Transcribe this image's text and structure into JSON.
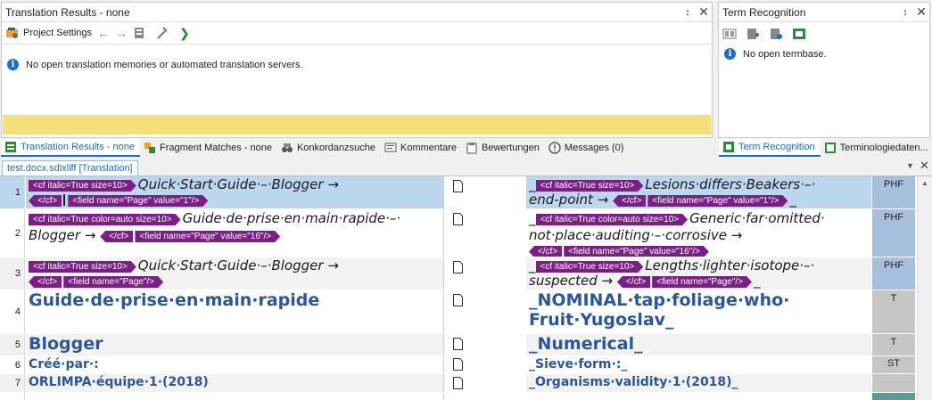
{
  "translation_results": {
    "title": "Translation Results - none",
    "toolbar_project_settings": "Project Settings",
    "message": "No open translation memories or automated translation servers."
  },
  "term_recognition": {
    "title": "Term Recognition",
    "message": "No open termbase."
  },
  "bottom_tabs": [
    {
      "label": "Translation Results - none"
    },
    {
      "label": "Fragment Matches - none"
    },
    {
      "label": "Konkordanzsuche"
    },
    {
      "label": "Kommentare"
    },
    {
      "label": "Bewertungen"
    },
    {
      "label": "Messages (0)"
    }
  ],
  "right_tabs": [
    {
      "label": "Term Recognition"
    },
    {
      "label": "Terminologiedaten..."
    }
  ],
  "editor_tab": "test.docx.sdlxliff [Translation]",
  "rows": [
    {
      "num": "1",
      "src_tag1": "<cf italic=True size=10>",
      "src_text": "Quick·Start·Guide·–·Blogger →",
      "src_tag2": "</cf>",
      "src_tag3": "<field name=\"Page\" value=\"1\"/>",
      "tgt_prefix": "_",
      "tgt_tag1": "<cf italic=True size=10>",
      "tgt_text": "Lesions·differs·Beakers·–·",
      "tgt_text2": "end-point →",
      "tgt_tag2": "</cf>",
      "tgt_tag3": "<field name=\"Page\" value=\"1\"/>",
      "tgt_suffix": "_",
      "status": "PHF"
    },
    {
      "num": "2",
      "src_tag1": "<cf italic=True color=auto size=10>",
      "src_text": "Guide·de·prise·en·main·rapide·–·",
      "src_text2": "Blogger →",
      "src_tag2": "</cf>",
      "src_tag3": "<field name=\"Page\" value=\"16\"/>",
      "tgt_prefix": "_",
      "tgt_tag1": "<cf italic=True color=auto size=10>",
      "tgt_text": "Generic·far·omitted·",
      "tgt_text2": "not·place·auditing·–·corrosive →",
      "tgt_tag2": "</cf>",
      "tgt_tag3": "<field name=\"Page\" value=\"16\"/>",
      "tgt_suffix": "_",
      "status": "PHF"
    },
    {
      "num": "3",
      "src_tag1": "<cf italic=True size=10>",
      "src_text": "Quick·Start·Guide·–·Blogger →",
      "src_tag2": "</cf>",
      "src_tag3": "<field name=\"Page\"/>",
      "tgt_prefix": "_",
      "tgt_tag1": "<cf italic=True size=10>",
      "tgt_text": "Lengths·lighter·isotope·–·",
      "tgt_text2": "suspected →",
      "tgt_tag2": "</cf>",
      "tgt_tag3": "<field name=\"Page\"/>",
      "tgt_suffix": "_",
      "status": "PHF"
    },
    {
      "num": "4",
      "src_text": "Guide·de·prise·en·main·rapide",
      "tgt_text": "_NOMINAL·tap·foliage·who·",
      "tgt_text2": "Fruit·Yugoslav_",
      "status": "T"
    },
    {
      "num": "5",
      "src_text": "Blogger",
      "tgt_text": "_Numerical_",
      "status": "T"
    },
    {
      "num": "6",
      "src_text": "Créé·par·:",
      "tgt_text": "_Sieve·form·:_",
      "status": "ST"
    },
    {
      "num": "7",
      "src_text": "ORLIMPA·équipe·1·(2018)",
      "tgt_text": "_Organisms·validity·1·(2018)_",
      "status": ""
    }
  ],
  "colors": {
    "accent": "#1c6fc4",
    "tag": "#7b1f86",
    "selected_row": "#bcd6ee",
    "highlight_bar": "#f2e07a"
  }
}
